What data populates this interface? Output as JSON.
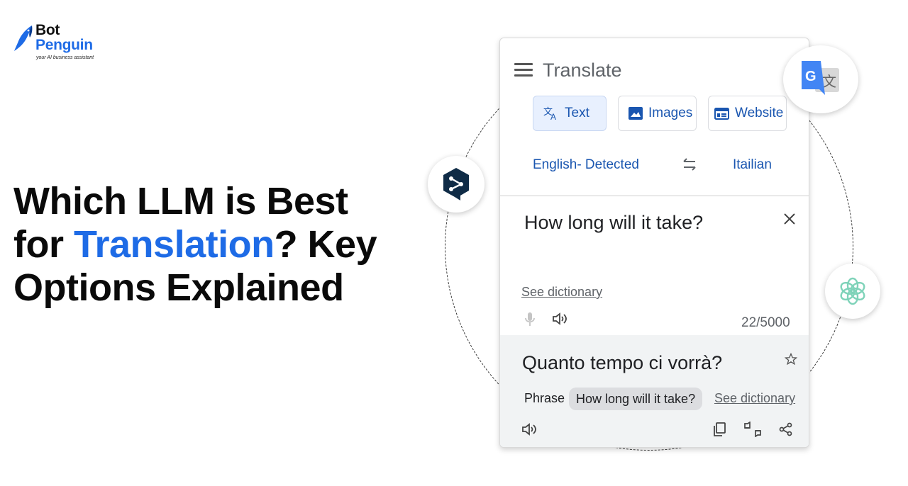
{
  "brand": {
    "name_line1": "Bot",
    "name_line2": "Penguin",
    "tagline": "your AI business assistant",
    "colors": {
      "accent": "#1e6be6",
      "dark": "#0a0a0a"
    }
  },
  "headline": {
    "part1": "Which LLM is Best",
    "part2_prefix": "for ",
    "part2_highlight": "Translation",
    "part2_suffix": "? Key",
    "part3": "Options Explained"
  },
  "translate_card": {
    "title": "Translate",
    "modes": [
      {
        "label": "Text",
        "icon": "translate-icon",
        "active": true
      },
      {
        "label": "Images",
        "icon": "image-icon",
        "active": false
      },
      {
        "label": "Website",
        "icon": "website-icon",
        "active": false
      }
    ],
    "source_language": "English- Detected",
    "target_language": "Itailian",
    "source_text": "How long will it take?",
    "see_dictionary": "See dictionary",
    "char_count": "22/5000",
    "translated_text": "Quanto tempo ci vorrà?",
    "phrase_label": "Phrase",
    "phrase_chip": "How long will it take?",
    "see_dictionary_result": "See dictionary",
    "link_color": "#1a56b0"
  },
  "floating_icons": [
    "google-translate-icon",
    "deepl-icon",
    "openai-icon"
  ]
}
